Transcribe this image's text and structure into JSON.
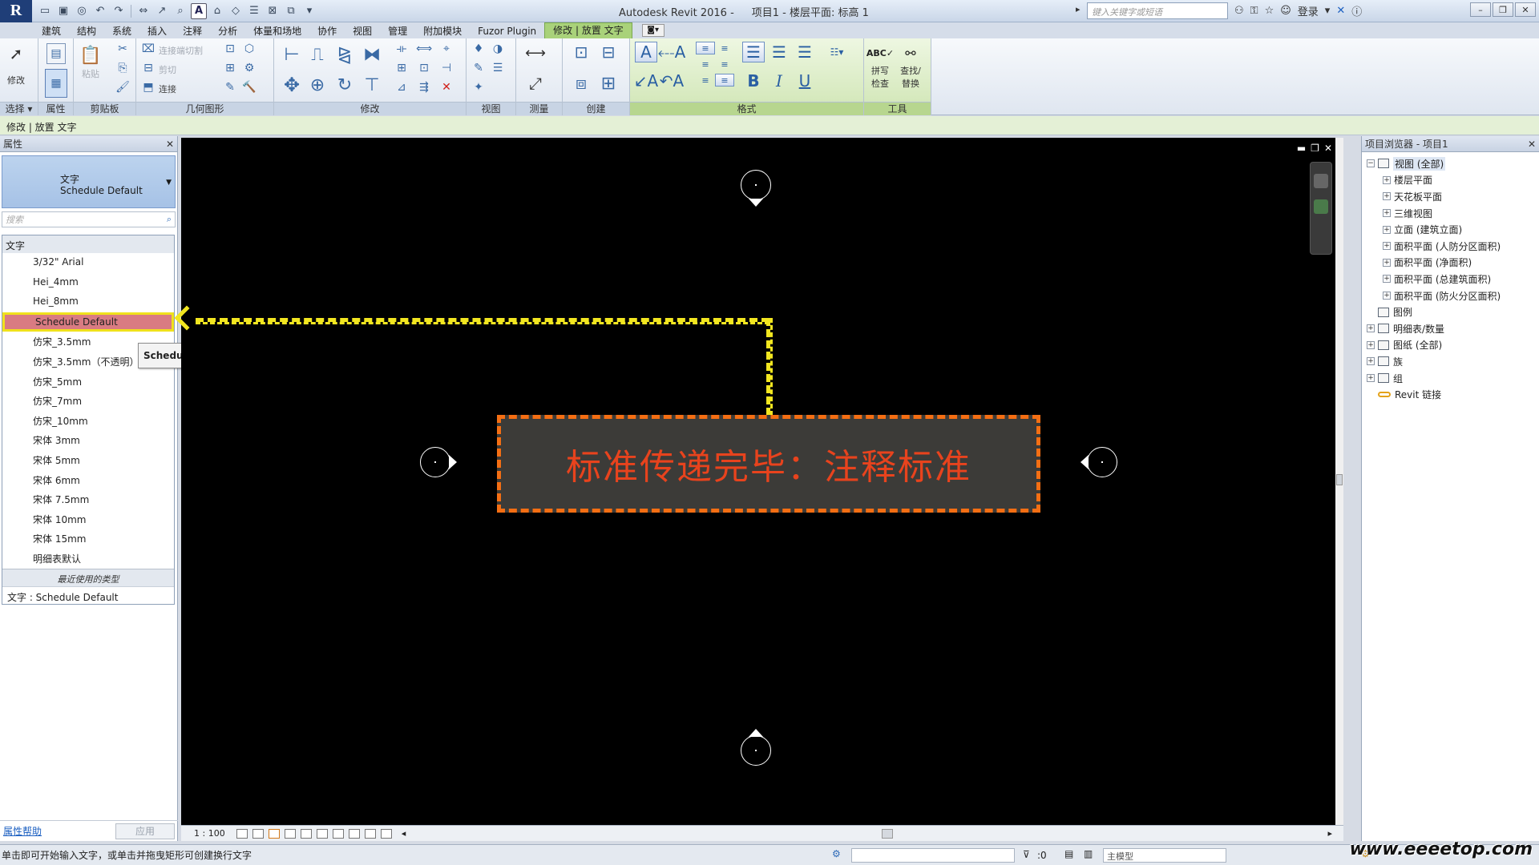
{
  "titlebar": {
    "app": "Autodesk Revit 2016 -",
    "project": "项目1 - 楼层平面: 标高 1",
    "search_placeholder": "键入关键字或短语",
    "login": "登录"
  },
  "tabs": [
    "建筑",
    "结构",
    "系统",
    "插入",
    "注释",
    "分析",
    "体量和场地",
    "协作",
    "视图",
    "管理",
    "附加模块",
    "Fuzor Plugin",
    "修改 | 放置 文字"
  ],
  "active_tab_index": 12,
  "ribbon": {
    "modify_label": "修改",
    "paste_label": "粘贴",
    "cut_label": "剪切",
    "connect_cut_label": "连接端切割",
    "join_label": "连接",
    "spell_label": "拼写\n检查",
    "spell_l1": "拼写",
    "spell_l2": "检查",
    "find_l1": "查找/",
    "find_l2": "替换",
    "panels": {
      "select": "选择",
      "properties": "属性",
      "clipboard": "剪贴板",
      "geometry": "几何图形",
      "modify": "修改",
      "view": "视图",
      "measure": "测量",
      "create": "创建",
      "format": "格式",
      "tools": "工具"
    }
  },
  "options_bar": "修改 | 放置 文字",
  "properties": {
    "title": "属性",
    "type_category": "文字",
    "type_name": "Schedule Default",
    "search_placeholder": "搜索",
    "group": "文字",
    "items": [
      "3/32\" Arial",
      "Hei_4mm",
      "Hei_8mm",
      "Schedule Default",
      "仿宋_3.5mm",
      "仿宋_3.5mm（不透明）",
      "仿宋_5mm",
      "仿宋_7mm",
      "仿宋_10mm",
      "宋体 3mm",
      "宋体 5mm",
      "宋体 6mm",
      "宋体 7.5mm",
      "宋体 10mm",
      "宋体 15mm",
      "明细表默认"
    ],
    "selected_index": 3,
    "recent_header": "最近使用的类型",
    "recent_item": "文字 : Schedule Default",
    "help_link": "属性帮助",
    "apply": "应用"
  },
  "tooltip": "Schedule Default",
  "canvas": {
    "banner_text": "标准传递完毕：注释标准"
  },
  "browser": {
    "title": "项目浏览器 - 项目1",
    "rows": [
      {
        "label": "视图 (全部)",
        "level": 0,
        "exp": "−",
        "icon": true,
        "hl": true
      },
      {
        "label": "楼层平面",
        "level": 1,
        "exp": "+",
        "icon": false
      },
      {
        "label": "天花板平面",
        "level": 1,
        "exp": "+",
        "icon": false
      },
      {
        "label": "三维视图",
        "level": 1,
        "exp": "+",
        "icon": false
      },
      {
        "label": "立面 (建筑立面)",
        "level": 1,
        "exp": "+",
        "icon": false
      },
      {
        "label": "面积平面 (人防分区面积)",
        "level": 1,
        "exp": "+",
        "icon": false
      },
      {
        "label": "面积平面 (净面积)",
        "level": 1,
        "exp": "+",
        "icon": false
      },
      {
        "label": "面积平面 (总建筑面积)",
        "level": 1,
        "exp": "+",
        "icon": false
      },
      {
        "label": "面积平面 (防火分区面积)",
        "level": 1,
        "exp": "+",
        "icon": false
      },
      {
        "label": "图例",
        "level": 0,
        "exp": "",
        "icon": true
      },
      {
        "label": "明细表/数量",
        "level": 0,
        "exp": "+",
        "icon": true
      },
      {
        "label": "图纸 (全部)",
        "level": 0,
        "exp": "+",
        "icon": true
      },
      {
        "label": "族",
        "level": 0,
        "exp": "+",
        "icon": true
      },
      {
        "label": "组",
        "level": 0,
        "exp": "+",
        "icon": true
      },
      {
        "label": "Revit 链接",
        "level": 0,
        "exp": "",
        "icon": "link"
      }
    ]
  },
  "viewbar": {
    "scale": "1 : 100"
  },
  "status": {
    "message": "单击即可开始输入文字，或单击并拖曳矩形可创建换行文字",
    "filter_count": ":0",
    "model": "主模型"
  },
  "watermark": "www.eeeetop.com",
  "colors": {
    "callout_yellow": "#f2e620",
    "banner_border": "#f46e13",
    "banner_text": "#e8431d",
    "selected_item": "#d97b82"
  }
}
